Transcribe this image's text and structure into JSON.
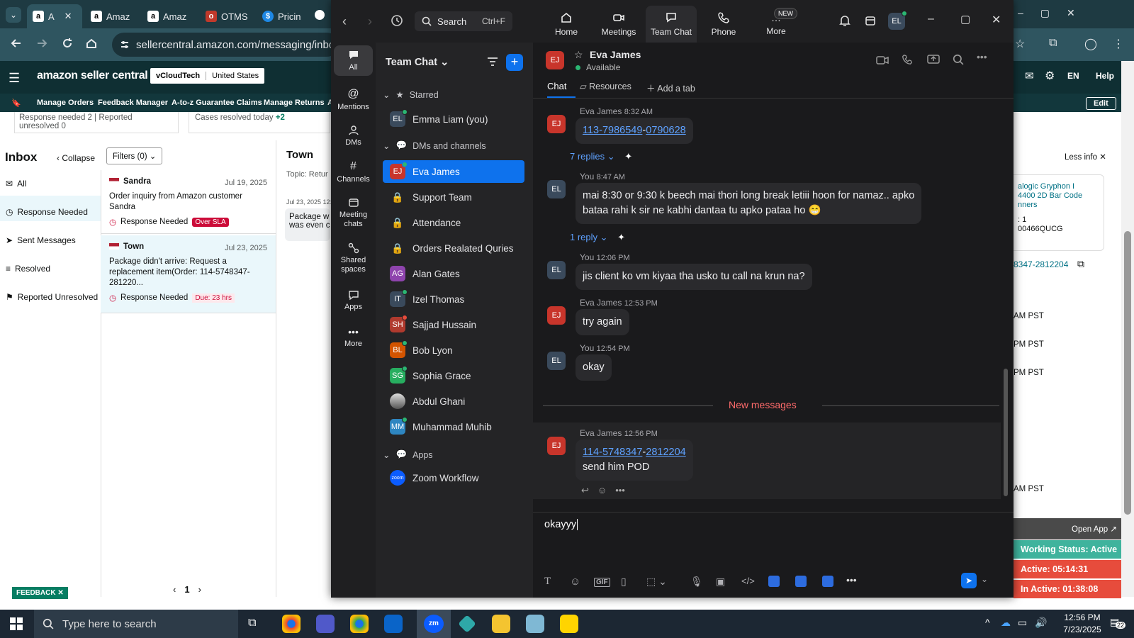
{
  "browser": {
    "tabs": [
      {
        "label": "A",
        "fav": "a"
      },
      {
        "label": "Amaz",
        "fav": "a"
      },
      {
        "label": "Amaz",
        "fav": "a"
      },
      {
        "label": "OTMS",
        "fav": "o"
      },
      {
        "label": "Pricin",
        "fav": "$"
      }
    ],
    "url": "sellercentral.amazon.com/messaging/inbox?"
  },
  "amazon": {
    "logo": "amazon seller central",
    "account": "vCloudTech",
    "country": "United States",
    "lang": "EN",
    "help": "Help",
    "nav": [
      "Manage Orders",
      "Feedback Manager",
      "A-to-z Guarantee Claims",
      "Manage Returns",
      "A"
    ],
    "edit": "Edit",
    "summary": {
      "response_needed": "Response needed 2",
      "reported": "Reported unresolved 0",
      "cases": "Cases resolved today",
      "cases_delta": "+2"
    },
    "inbox_title": "Inbox",
    "collapse": "Collapse",
    "filters": "Filters (0)",
    "folders": [
      "All",
      "Response Needed",
      "Sent Messages",
      "Resolved",
      "Reported Unresolved"
    ],
    "threads": [
      {
        "name": "Sandra",
        "date": "Jul 19, 2025",
        "text": "Order inquiry from Amazon customer Sandra",
        "status": "Response Needed",
        "tag": "Over SLA"
      },
      {
        "name": "Town",
        "date": "Jul 23, 2025",
        "text": "Package didn't arrive: Request a replacement item(Order: 114-5748347-281220...",
        "status": "Response Needed",
        "tag": "Due: 23 hrs"
      }
    ],
    "page": "1",
    "feedback": "FEEDBACK",
    "detail": {
      "title": "Town",
      "topic": "Topic: Retur",
      "date": "Jul 23, 2025 12:",
      "preview1": "Package w",
      "preview2": "was even c"
    },
    "right": {
      "less_info": "Less info",
      "product": [
        "alogic Gryphon I",
        "4400 2D Bar Code",
        "nners"
      ],
      "qty": ": 1",
      "asin": "00466QUCG",
      "order": "8347-2812204",
      "times": [
        "AM PST",
        "PM PST",
        "PM PST",
        "AM PST"
      ],
      "open_app": "Open App",
      "working": "Working Status: Active",
      "active": "Active: 05:14:31",
      "inactive": "In Active: 01:38:08"
    }
  },
  "zoom": {
    "search": "Search",
    "shortcut": "Ctrl+F",
    "tabs": [
      "Home",
      "Meetings",
      "Team Chat",
      "Phone",
      "More"
    ],
    "new_badge": "NEW",
    "user_initials": "EL",
    "rail": [
      "All",
      "Mentions",
      "DMs",
      "Channels",
      "Meeting chats",
      "Shared spaces",
      "Apps",
      "More"
    ],
    "list_title": "Team Chat",
    "sections": {
      "starred": "Starred",
      "dms": "DMs and channels",
      "apps": "Apps"
    },
    "starred": [
      {
        "init": "EL",
        "name": "Emma Liam (you)",
        "color": "#3a4a5c"
      }
    ],
    "channels": [
      {
        "init": "EJ",
        "name": "Eva James",
        "color": "#c8352b"
      },
      {
        "init": "",
        "name": "Support Team",
        "color": "lock"
      },
      {
        "init": "",
        "name": "Attendance",
        "color": "lock"
      },
      {
        "init": "",
        "name": "Orders Realated Quries",
        "color": "lock"
      },
      {
        "init": "AG",
        "name": "Alan Gates",
        "color": "#8e44ad"
      },
      {
        "init": "IT",
        "name": "Izel Thomas",
        "color": "#3a4a5c"
      },
      {
        "init": "SH",
        "name": "Sajjad Hussain",
        "color": "#b03a2e"
      },
      {
        "init": "BL",
        "name": "Bob Lyon",
        "color": "#d35400"
      },
      {
        "init": "SG",
        "name": "Sophia Grace",
        "color": "#27ae60"
      },
      {
        "init": "",
        "name": "Abdul Ghani",
        "color": "photo"
      },
      {
        "init": "MM",
        "name": "Muhammad Muhib",
        "color": "#2e86c1"
      }
    ],
    "apps": [
      {
        "init": "zoom",
        "name": "Zoom Workflow",
        "color": "#0b5cff"
      }
    ],
    "chat": {
      "name": "Eva James",
      "presence": "Available",
      "tabs": [
        "Chat",
        "Resources",
        "Add a tab"
      ],
      "new_messages": "New messages",
      "compose_text": "okayyy"
    },
    "messages": [
      {
        "who": "EJ",
        "head": "Eva James",
        "time": "8:32 AM",
        "parts": [
          "113-7986549",
          "-",
          "0790628"
        ],
        "replies": "7 replies"
      },
      {
        "who": "EL",
        "head": "You",
        "time": "8:47 AM",
        "line1": "mai 8:30 or 9:30 k beech mai thori long break letiii hoon for namaz.. apko",
        "line2": "bataa rahi k sir ne kabhi dantaa tu apko pataa ho",
        "emoji": "😁",
        "replies": "1 reply"
      },
      {
        "who": "EL",
        "head": "You",
        "time": "12:06 PM",
        "text": "jis client ko vm kiyaa tha usko tu call na krun na?"
      },
      {
        "who": "EJ",
        "head": "Eva James",
        "time": "12:53 PM",
        "text": "try again"
      },
      {
        "who": "EL",
        "head": "You",
        "time": "12:54 PM",
        "text": "okay"
      },
      {
        "who": "EJ",
        "head": "Eva James",
        "time": "12:56 PM",
        "parts": [
          "114-5748347",
          "-",
          "2812204"
        ],
        "line2": "send him POD"
      }
    ]
  },
  "taskbar": {
    "search": "Type here to search",
    "time": "12:56 PM",
    "date": "7/23/2025",
    "notif": "22"
  }
}
